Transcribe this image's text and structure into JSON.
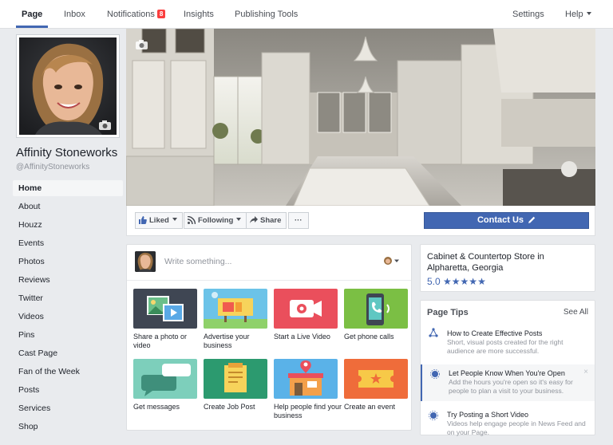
{
  "topnav": {
    "items": [
      {
        "label": "Page"
      },
      {
        "label": "Inbox"
      },
      {
        "label": "Notifications",
        "badge": "8"
      },
      {
        "label": "Insights"
      },
      {
        "label": "Publishing Tools"
      },
      {
        "label": "Settings"
      },
      {
        "label": "Help"
      }
    ]
  },
  "page": {
    "name": "Affinity Stoneworks",
    "handle": "@AffinityStoneworks"
  },
  "leftnav": {
    "items": [
      "Home",
      "About",
      "Houzz",
      "Events",
      "Photos",
      "Reviews",
      "Twitter",
      "Videos",
      "Pins",
      "Cast Page",
      "Fan of the Week",
      "Posts",
      "Services",
      "Shop"
    ]
  },
  "actions": {
    "liked": "Liked",
    "following": "Following",
    "share": "Share",
    "more": "···",
    "contact": "Contact Us"
  },
  "composer": {
    "placeholder": "Write something...",
    "tiles": [
      {
        "label": "Share a photo or video"
      },
      {
        "label": "Advertise your business"
      },
      {
        "label": "Start a Live Video"
      },
      {
        "label": "Get phone calls"
      },
      {
        "label": "Get messages"
      },
      {
        "label": "Create Job Post"
      },
      {
        "label": "Help people find your business"
      },
      {
        "label": "Create an event"
      }
    ]
  },
  "about": {
    "category": "Cabinet & Countertop Store in Alpharetta, Georgia",
    "rating": "5.0",
    "stars": "★★★★★"
  },
  "tips": {
    "heading": "Page Tips",
    "see_all": "See All",
    "items": [
      {
        "title": "How to Create Effective Posts",
        "desc": "Short, visual posts created for the right audience are more successful."
      },
      {
        "title": "Let People Know When You're Open",
        "desc": "Add the hours you're open so it's easy for people to plan a visit to your business."
      },
      {
        "title": "Try Posting a Short Video",
        "desc": "Videos help engage people in News Feed and on your Page."
      }
    ],
    "close": "×"
  },
  "colors": {
    "accent": "#4267b2",
    "badge": "#fa3e3e"
  }
}
